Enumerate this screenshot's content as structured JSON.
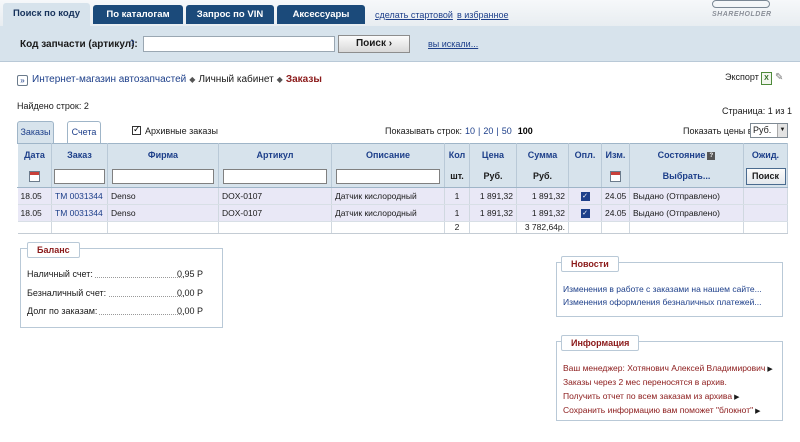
{
  "topnav": {
    "tabs": [
      "Поиск по коду",
      "По каталогам",
      "Запрос по VIN",
      "Аксессуары"
    ],
    "links": [
      "сделать стартовой",
      "в избранное"
    ],
    "logo_text": "SHAREHOLDER"
  },
  "search": {
    "label": "Код запчасти (артикул):",
    "help": "?",
    "value": "",
    "button": "Поиск ›",
    "recent_link": "вы искали..."
  },
  "breadcrumb": {
    "home_icon": "home-icon",
    "items": [
      "Интернет-магазин автозапчастей",
      "Личный кабинет",
      "Заказы"
    ],
    "sep": "◆"
  },
  "export": {
    "label": "Экспорт",
    "xl": "X"
  },
  "found": "Найдено строк: 2",
  "pagination": "Страница: 1 из 1",
  "subtabs": [
    "Заказы",
    "Счета"
  ],
  "archive": {
    "label": "Архивные заказы",
    "checked": true
  },
  "rows_per_page": {
    "label": "Показывать строк:",
    "options": [
      "10",
      "20",
      "50",
      "100"
    ],
    "selected": "100"
  },
  "price_in": {
    "label": "Показать цены в:",
    "value": "Руб."
  },
  "table": {
    "headers": [
      "Дата",
      "Заказ",
      "Фирма",
      "Артикул",
      "Описание",
      "Кол",
      "Цена",
      "Сумма",
      "Опл.",
      "Изм.",
      "Состояние",
      "Ожид."
    ],
    "units": {
      "qty": "шт.",
      "price": "Руб.",
      "sum": "Руб."
    },
    "state_filter": "Выбрать...",
    "find_button": "Поиск",
    "rows": [
      {
        "date": "18.05",
        "order": "TM 0031344",
        "brand": "Denso",
        "article": "DOX-0107",
        "desc": "Датчик кислородный",
        "qty": "1",
        "price": "1 891,32",
        "sum": "1 891,32",
        "paid": true,
        "changed": "24.05",
        "state": "Выдано (Отправлено)",
        "expected": ""
      },
      {
        "date": "18.05",
        "order": "TM 0031344",
        "brand": "Denso",
        "article": "DOX-0107",
        "desc": "Датчик кислородный",
        "qty": "1",
        "price": "1 891,32",
        "sum": "1 891,32",
        "paid": true,
        "changed": "24.05",
        "state": "Выдано (Отправлено)",
        "expected": ""
      }
    ],
    "total": {
      "qty": "2",
      "sum": "3 782,64р."
    }
  },
  "balance": {
    "title": "Баланс",
    "lines": [
      {
        "label": "Наличный счет:",
        "value": "0,95 Р"
      },
      {
        "label": "Безналичный счет:",
        "value": "0,00 Р"
      },
      {
        "label": "Долг по заказам:",
        "value": "0,00 Р"
      }
    ]
  },
  "news": {
    "title": "Новости",
    "items": [
      "Изменения в работе с заказами на нашем сайте...",
      "Изменения оформления безналичных платежей..."
    ]
  },
  "info": {
    "title": "Информация",
    "items": [
      "Ваш менеджер: Хотянович Алексей Владимирович",
      "Заказы через 2 мес переносятся в архив.",
      "Получить отчет по всем заказам из архива",
      "Сохранить информацию вам поможет \"блокнот\""
    ]
  }
}
